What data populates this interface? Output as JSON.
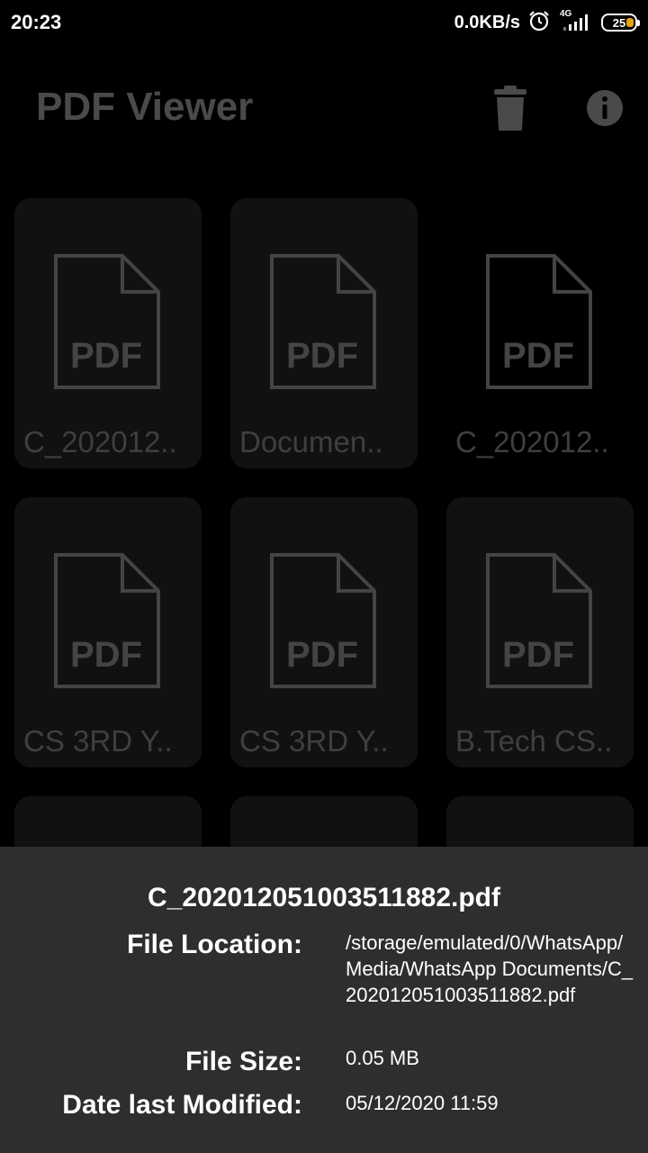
{
  "status_bar": {
    "time": "20:23",
    "net_speed": "0.0KB/s",
    "network_type": "4G",
    "battery": "25",
    "icons": [
      "alarm-icon",
      "signal-icon",
      "battery-icon"
    ]
  },
  "header": {
    "title": "PDF Viewer",
    "icons": [
      "trash-icon",
      "info-icon"
    ]
  },
  "files": [
    {
      "name": "C_202012.."
    },
    {
      "name": "Documen.."
    },
    {
      "name": "C_202012.."
    },
    {
      "name": "CS 3RD Y.."
    },
    {
      "name": "CS 3RD Y.."
    },
    {
      "name": "B.Tech CS.."
    }
  ],
  "pdf_icon_text": "PDF",
  "details_sheet": {
    "file_name": "C_20201205100351188​2.pdf",
    "location_label": "File Location:",
    "location_value": "/storage/emulated/0/WhatsApp/Media/WhatsApp Documents/C_20201205100351188​2.pdf",
    "size_label": "File Size:",
    "size_value": "0.05 MB",
    "modified_label": "Date last Modified:",
    "modified_value": "05/12/2020 11:59"
  },
  "colors": {
    "background": "#000000",
    "card": "#111111",
    "sheet": "#2e2e2e",
    "muted_text": "#4a4a4a",
    "battery_accent": "#e8a317"
  }
}
